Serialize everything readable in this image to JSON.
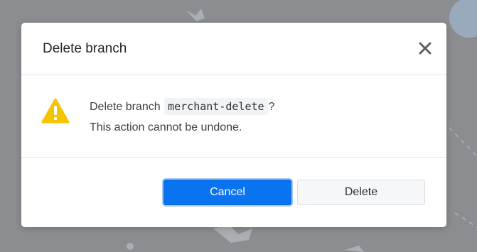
{
  "dialog": {
    "title": "Delete branch",
    "message_prefix": "Delete branch",
    "branch_name": "merchant-delete",
    "message_suffix": "?",
    "message_line2": "This action cannot be undone.",
    "cancel_label": "Cancel",
    "delete_label": "Delete"
  },
  "icons": {
    "close": "close-icon",
    "warning": "warning-icon"
  },
  "colors": {
    "primary": "#0a73f0",
    "warning": "#f5c400",
    "backdrop": "#8b8d90"
  }
}
